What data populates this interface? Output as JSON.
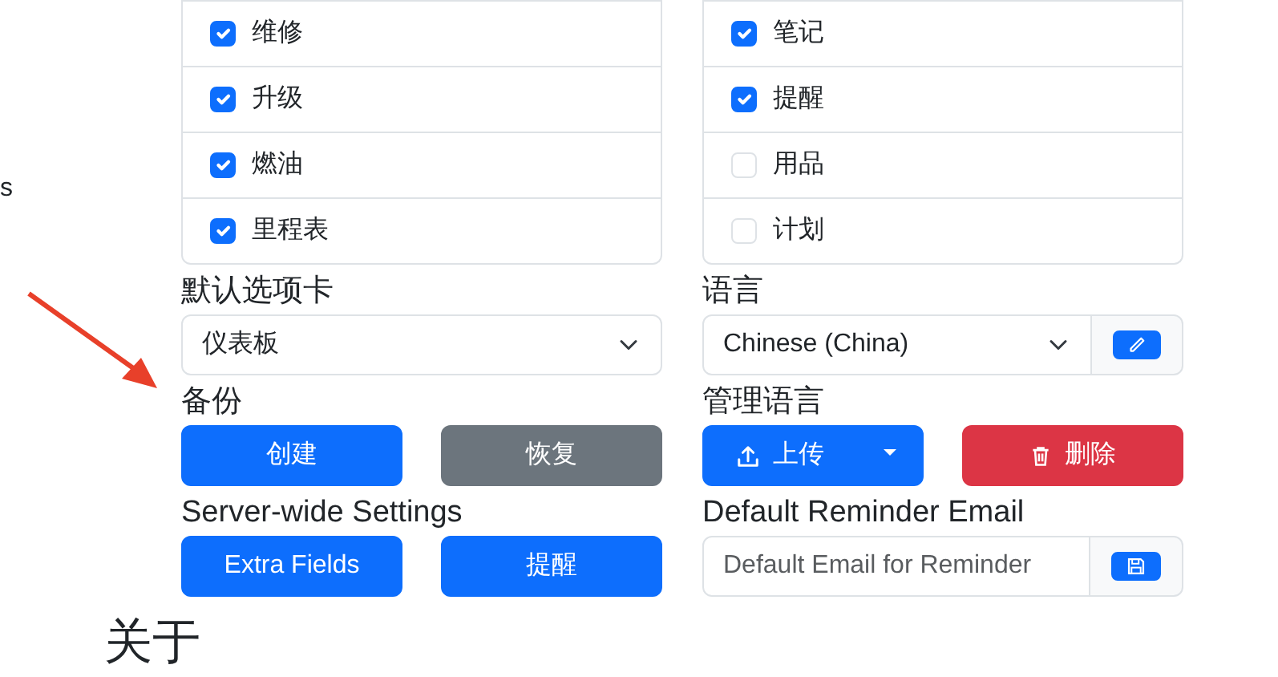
{
  "side_fragment": "s",
  "left_checklist": [
    {
      "label": "维修",
      "checked": true
    },
    {
      "label": "升级",
      "checked": true
    },
    {
      "label": "燃油",
      "checked": true
    },
    {
      "label": "里程表",
      "checked": true
    }
  ],
  "right_checklist": [
    {
      "label": "笔记",
      "checked": true
    },
    {
      "label": "提醒",
      "checked": true
    },
    {
      "label": "用品",
      "checked": false
    },
    {
      "label": "计划",
      "checked": false
    }
  ],
  "default_tab": {
    "label": "默认选项卡",
    "value": "仪表板"
  },
  "language": {
    "label": "语言",
    "value": "Chinese (China)"
  },
  "backup": {
    "label": "备份",
    "buttons": [
      "创建",
      "恢复"
    ]
  },
  "manage_language": {
    "label": "管理语言",
    "buttons": [
      "上传",
      "删除"
    ]
  },
  "server_wide_settings": {
    "label": "Server-wide Settings",
    "buttons": [
      "Extra Fields",
      "提醒"
    ]
  },
  "default_reminder_email": {
    "label": "Default Reminder Email",
    "placeholder": "Default Email for Reminder"
  },
  "section_heading": "关于"
}
